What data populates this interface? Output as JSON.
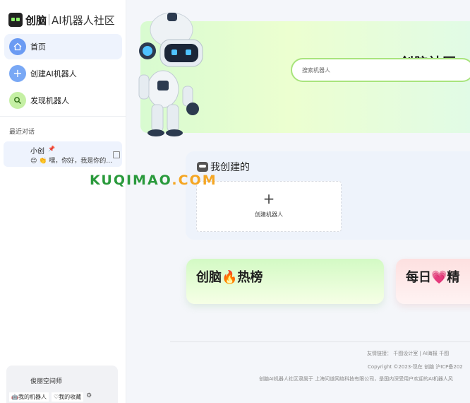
{
  "brand": {
    "name_cn": "创脑",
    "name_en": "AI机器人社区"
  },
  "nav": {
    "items": [
      {
        "label": "首页",
        "icon": "home-icon",
        "active": true
      },
      {
        "label": "创建AI机器人",
        "icon": "plus-icon",
        "active": false
      },
      {
        "label": "发现机器人",
        "icon": "search-icon",
        "active": false
      }
    ]
  },
  "recent": {
    "title": "最近对话",
    "chat": {
      "name": "小创",
      "message": "😊 👏 嘿，你好，我是你的…"
    }
  },
  "user": {
    "name": "俊丽空间师",
    "links": [
      "🤖我的机器人",
      "♡我的收藏"
    ]
  },
  "banner": {
    "title": "创脑社区：全",
    "search_placeholder": "搜索机器人"
  },
  "mine": {
    "title": "我创建的",
    "create_plus": "+",
    "create_label": "创建机器人"
  },
  "hot": {
    "title": "创脑🔥热榜"
  },
  "daily": {
    "title": "每日💗精"
  },
  "footer": {
    "links": "友情链接：    千图设计室 | AI海报    千图",
    "copyright": "Copyright ©2023-现在 创脑  沪ICP备202",
    "about": "创脑AI机器人社区隶属于 上海问道网络科技有限公司，是国内深受用户欢迎的AI机器人风"
  },
  "watermark": {
    "part1": "KUQIMAO",
    "part2": ".COM"
  },
  "colors": {
    "accent": "#a8e47c",
    "nav_active": "#eef3fd",
    "watermark": "#2a9a3c"
  }
}
